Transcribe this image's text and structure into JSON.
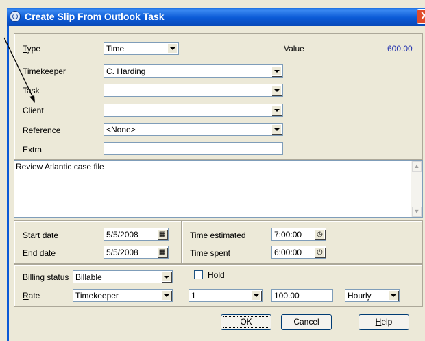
{
  "window": {
    "title": "Create Slip From Outlook Task",
    "close_glyph": "X"
  },
  "fields": {
    "type": {
      "label_first": "T",
      "label_rest": "ype",
      "value": "Time"
    },
    "value_label": "Value",
    "value_amount": "600.00",
    "timekeeper": {
      "label_first": "T",
      "label_rest": "imekeeper",
      "value": "C. Harding"
    },
    "task": {
      "label": "Task",
      "value": ""
    },
    "client": {
      "label": "Client",
      "value": ""
    },
    "reference": {
      "label": "Reference",
      "value": "<None>"
    },
    "extra": {
      "label": "Extra",
      "value": ""
    },
    "description": "Review Atlantic case file"
  },
  "dates": {
    "start_label_first": "S",
    "start_label_rest": "tart date",
    "start_value": "5/5/2008",
    "end_label_first": "E",
    "end_label_rest": "nd date",
    "end_value": "5/5/2008",
    "est_label_first": "T",
    "est_label_rest": "ime estimated",
    "est_value": "7:00:00",
    "spent_label_a": "Time s",
    "spent_label_u": "p",
    "spent_label_b": "ent",
    "spent_value": "6:00:00"
  },
  "billing": {
    "status_label_first": "B",
    "status_label_rest": "illing status",
    "status_value": "Billable",
    "hold_label_a": "H",
    "hold_label_u": "o",
    "hold_label_b": "ld",
    "rate_label_first": "R",
    "rate_label_rest": "ate",
    "rate_source": "Timekeeper",
    "rate_level": "1",
    "rate_amount": "100.00",
    "rate_unit": "Hourly"
  },
  "buttons": {
    "ok": "OK",
    "cancel": "Cancel",
    "help_first": "H",
    "help_rest": "elp"
  },
  "icons": [
    "app-icon",
    "close-icon",
    "calendar-icon",
    "clock-icon",
    "dropdown-arrow-icon",
    "scroll-up-icon",
    "scroll-down-icon"
  ],
  "colors": {
    "titlebar": "#0b5ad6",
    "value_amount": "#1f2fae",
    "dialog_bg": "#ece9d8"
  }
}
